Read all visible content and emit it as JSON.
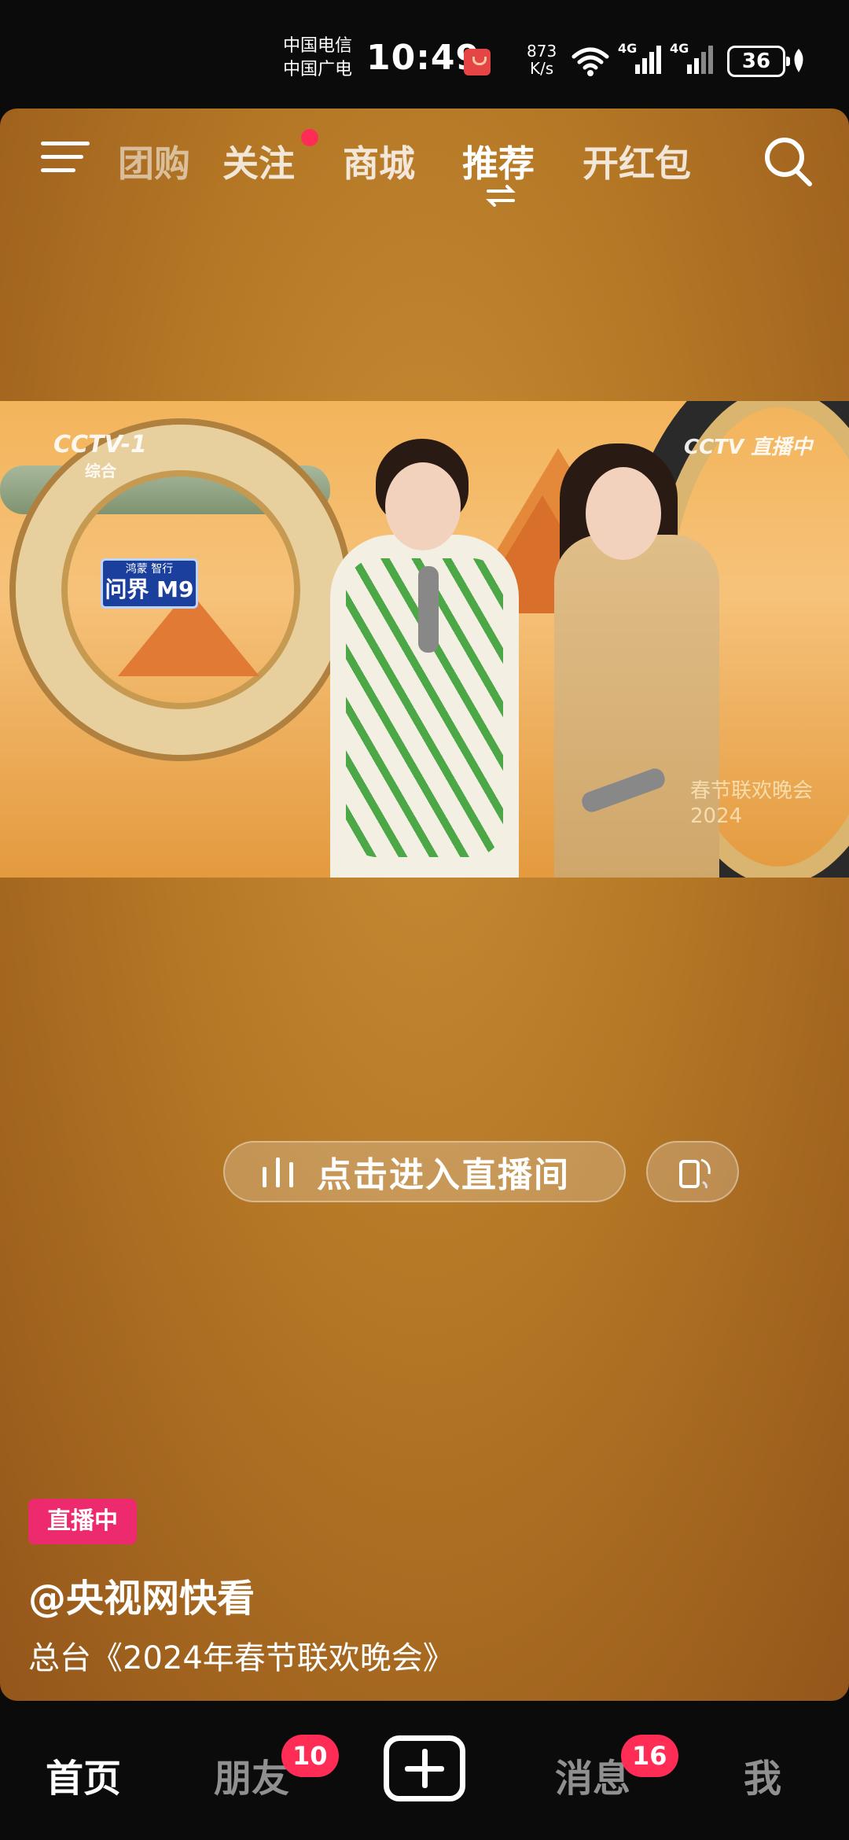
{
  "status_bar": {
    "carrier_1": "中国电信",
    "carrier_2": "中国广电",
    "time": "10:49",
    "net_speed_value": "873",
    "net_speed_unit": "K/s",
    "signal_1": "4G",
    "signal_2": "4G",
    "battery": "36"
  },
  "top_nav": {
    "tabs": [
      {
        "label": "团购"
      },
      {
        "label": "关注"
      },
      {
        "label": "商城"
      },
      {
        "label": "推荐"
      },
      {
        "label": "开红包"
      }
    ],
    "active_tab": "推荐"
  },
  "video": {
    "logo_left": "CCTV-1",
    "logo_left_sub": "综合",
    "sponsor_top": "鸿蒙 智行",
    "sponsor_main": "问界 M9",
    "logo_right": "CCTV 直播中",
    "gala_line1": "春节联欢晚会",
    "gala_line2": "2024"
  },
  "live_room": {
    "enter_label": "点击进入直播间"
  },
  "post": {
    "live_badge": "直播中",
    "author": "@央视网快看",
    "description": "总台《2024年春节联欢晚会》"
  },
  "bottom_nav": {
    "home": "首页",
    "friends": "朋友",
    "friends_badge": "10",
    "messages": "消息",
    "messages_badge": "16",
    "me": "我"
  },
  "colors": {
    "accent": "#ff2c55",
    "live_badge": "#ec2a6d",
    "background": "#b47725"
  }
}
